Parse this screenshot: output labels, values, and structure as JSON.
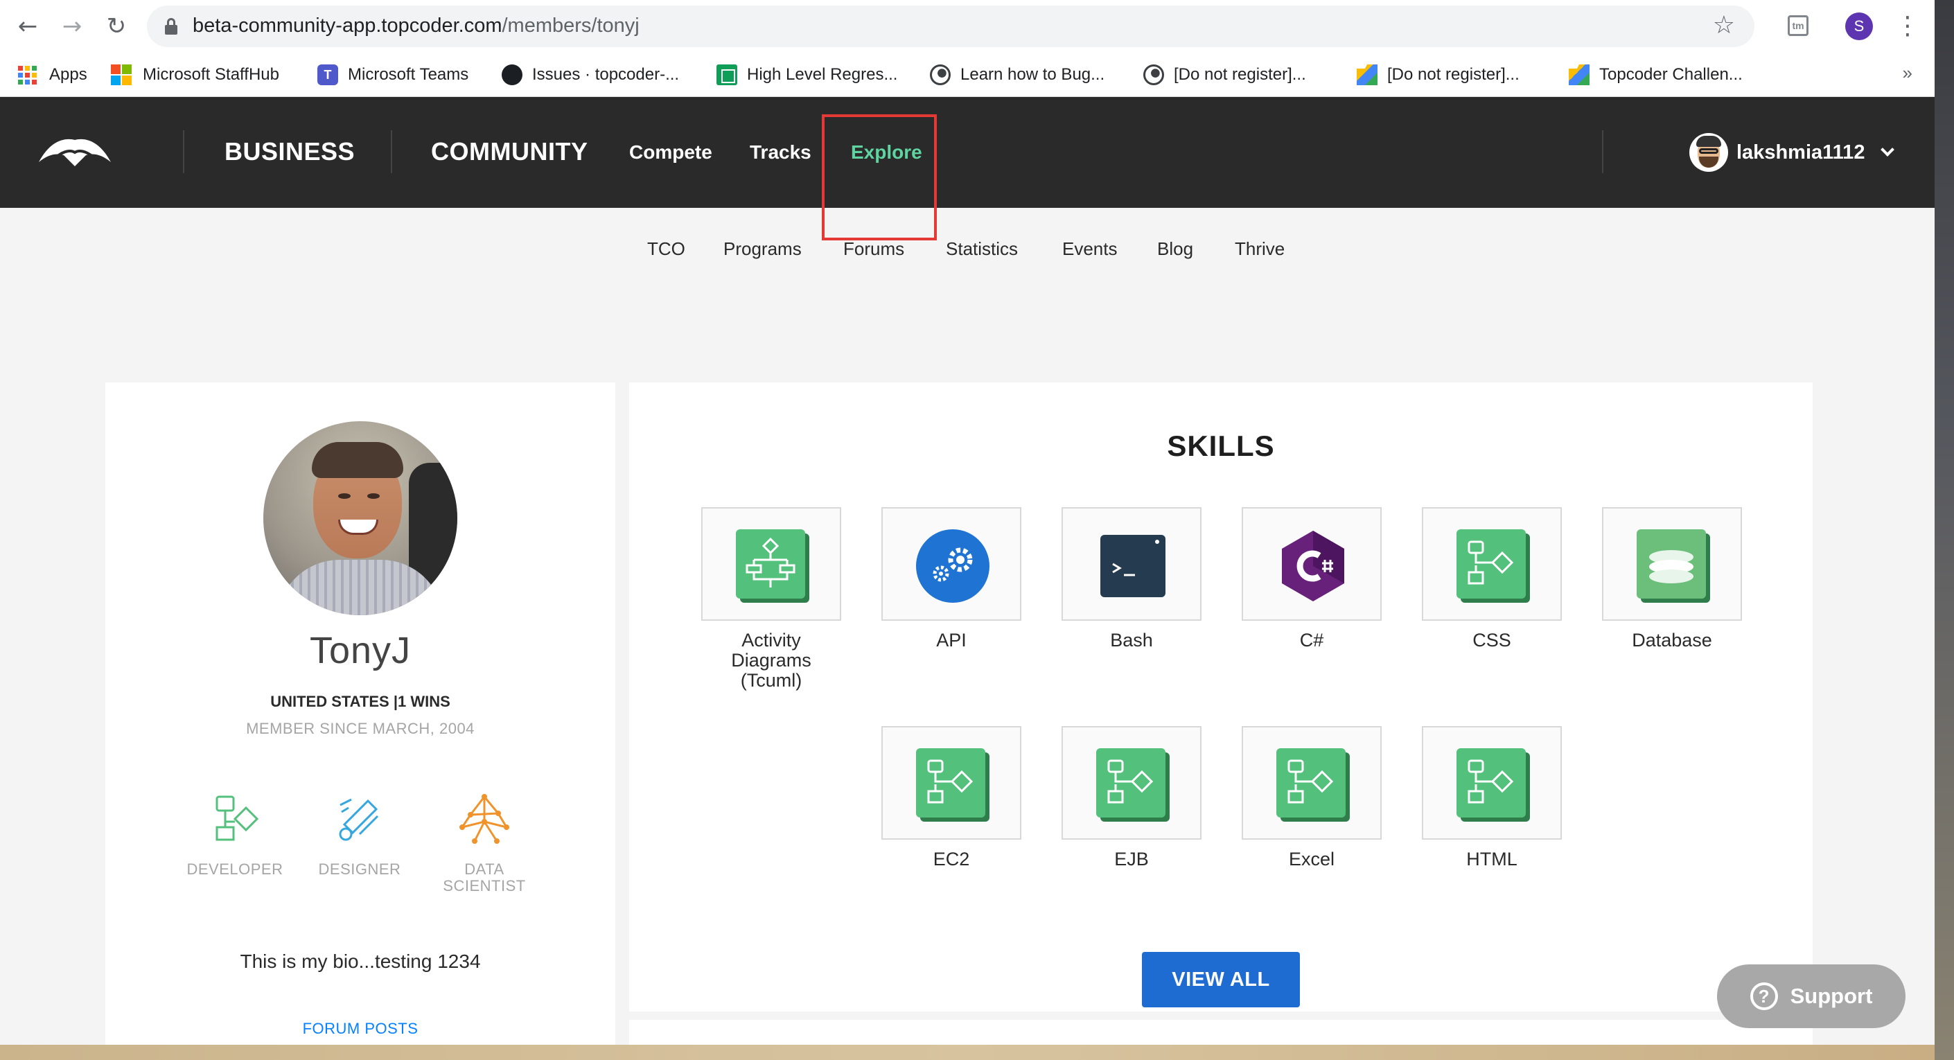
{
  "browser": {
    "url_host": "beta-community-app.topcoder.com",
    "url_path": "/members/tonyj",
    "profile_initial": "S",
    "extension_label": "tm",
    "bookmarks_more": "»",
    "bookmarks": [
      {
        "label": "Apps",
        "icon": "apps-grid-icon"
      },
      {
        "label": "Microsoft StaffHub",
        "icon": "microsoft-logo-icon"
      },
      {
        "label": "Microsoft Teams",
        "icon": "teams-icon"
      },
      {
        "label": "Issues · topcoder-...",
        "icon": "github-icon"
      },
      {
        "label": "High Level Regres...",
        "icon": "sheets-icon"
      },
      {
        "label": "Learn how to Bug...",
        "icon": "globe-icon"
      },
      {
        "label": "[Do not register]...",
        "icon": "globe-icon"
      },
      {
        "label": "[Do not register]...",
        "icon": "drive-folder-icon"
      },
      {
        "label": "Topcoder Challen...",
        "icon": "drive-folder-icon"
      }
    ]
  },
  "header": {
    "business": "BUSINESS",
    "community": "COMMUNITY",
    "compete": "Compete",
    "tracks": "Tracks",
    "explore": "Explore",
    "username": "lakshmia1112"
  },
  "subnav": [
    "TCO",
    "Programs",
    "Forums",
    "Statistics",
    "Events",
    "Blog",
    "Thrive"
  ],
  "profile": {
    "handle": "TonyJ",
    "country_wins": "UNITED STATES |1 WINS",
    "member_since": "MEMBER SINCE MARCH, 2004",
    "tracks": [
      {
        "label": "DEVELOPER"
      },
      {
        "label": "DESIGNER"
      },
      {
        "label": "DATA SCIENTIST"
      }
    ],
    "bio": "This is my bio...testing 1234",
    "forum_posts": "FORUM POSTS"
  },
  "skills": {
    "title": "SKILLS",
    "items": [
      {
        "label": "Activity Diagrams (Tcuml)",
        "icon": "activity-diagram-icon"
      },
      {
        "label": "API",
        "icon": "api-gears-icon"
      },
      {
        "label": "Bash",
        "icon": "terminal-icon"
      },
      {
        "label": "C#",
        "icon": "csharp-icon"
      },
      {
        "label": "CSS",
        "icon": "generic-skill-icon"
      },
      {
        "label": "Database",
        "icon": "database-icon"
      },
      {
        "label": "EC2",
        "icon": "generic-skill-icon"
      },
      {
        "label": "EJB",
        "icon": "generic-skill-icon"
      },
      {
        "label": "Excel",
        "icon": "generic-skill-icon"
      },
      {
        "label": "HTML",
        "icon": "generic-skill-icon"
      }
    ],
    "view_all": "VIEW ALL"
  },
  "support": "Support",
  "colors": {
    "header_bg": "#2a2a2a",
    "explore_active": "#5fd4a0",
    "highlight_box": "#e53935",
    "view_all_bg": "#1e6bd1",
    "skill_green": "#53c17c"
  }
}
